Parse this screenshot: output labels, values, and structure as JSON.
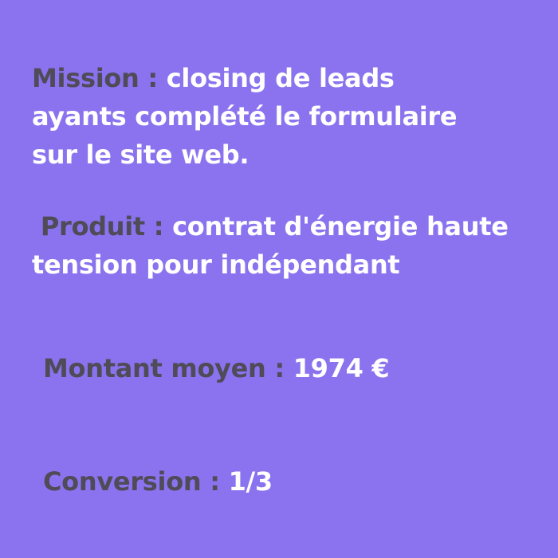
{
  "colors": {
    "background": "#8b73ef",
    "label": "#4f4b57",
    "value": "#ffffff"
  },
  "mission": {
    "label": "Mission :",
    "lines": [
      "closing de leads",
      "ayants complété le formulaire",
      "sur le site web."
    ]
  },
  "produit": {
    "label": "Produit :",
    "lines": [
      "contrat d'énergie haute",
      "tension pour indépendant"
    ]
  },
  "montant": {
    "label": "Montant moyen :",
    "value": "1974 €"
  },
  "conversion": {
    "label": "Conversion :",
    "value": "1/3"
  }
}
